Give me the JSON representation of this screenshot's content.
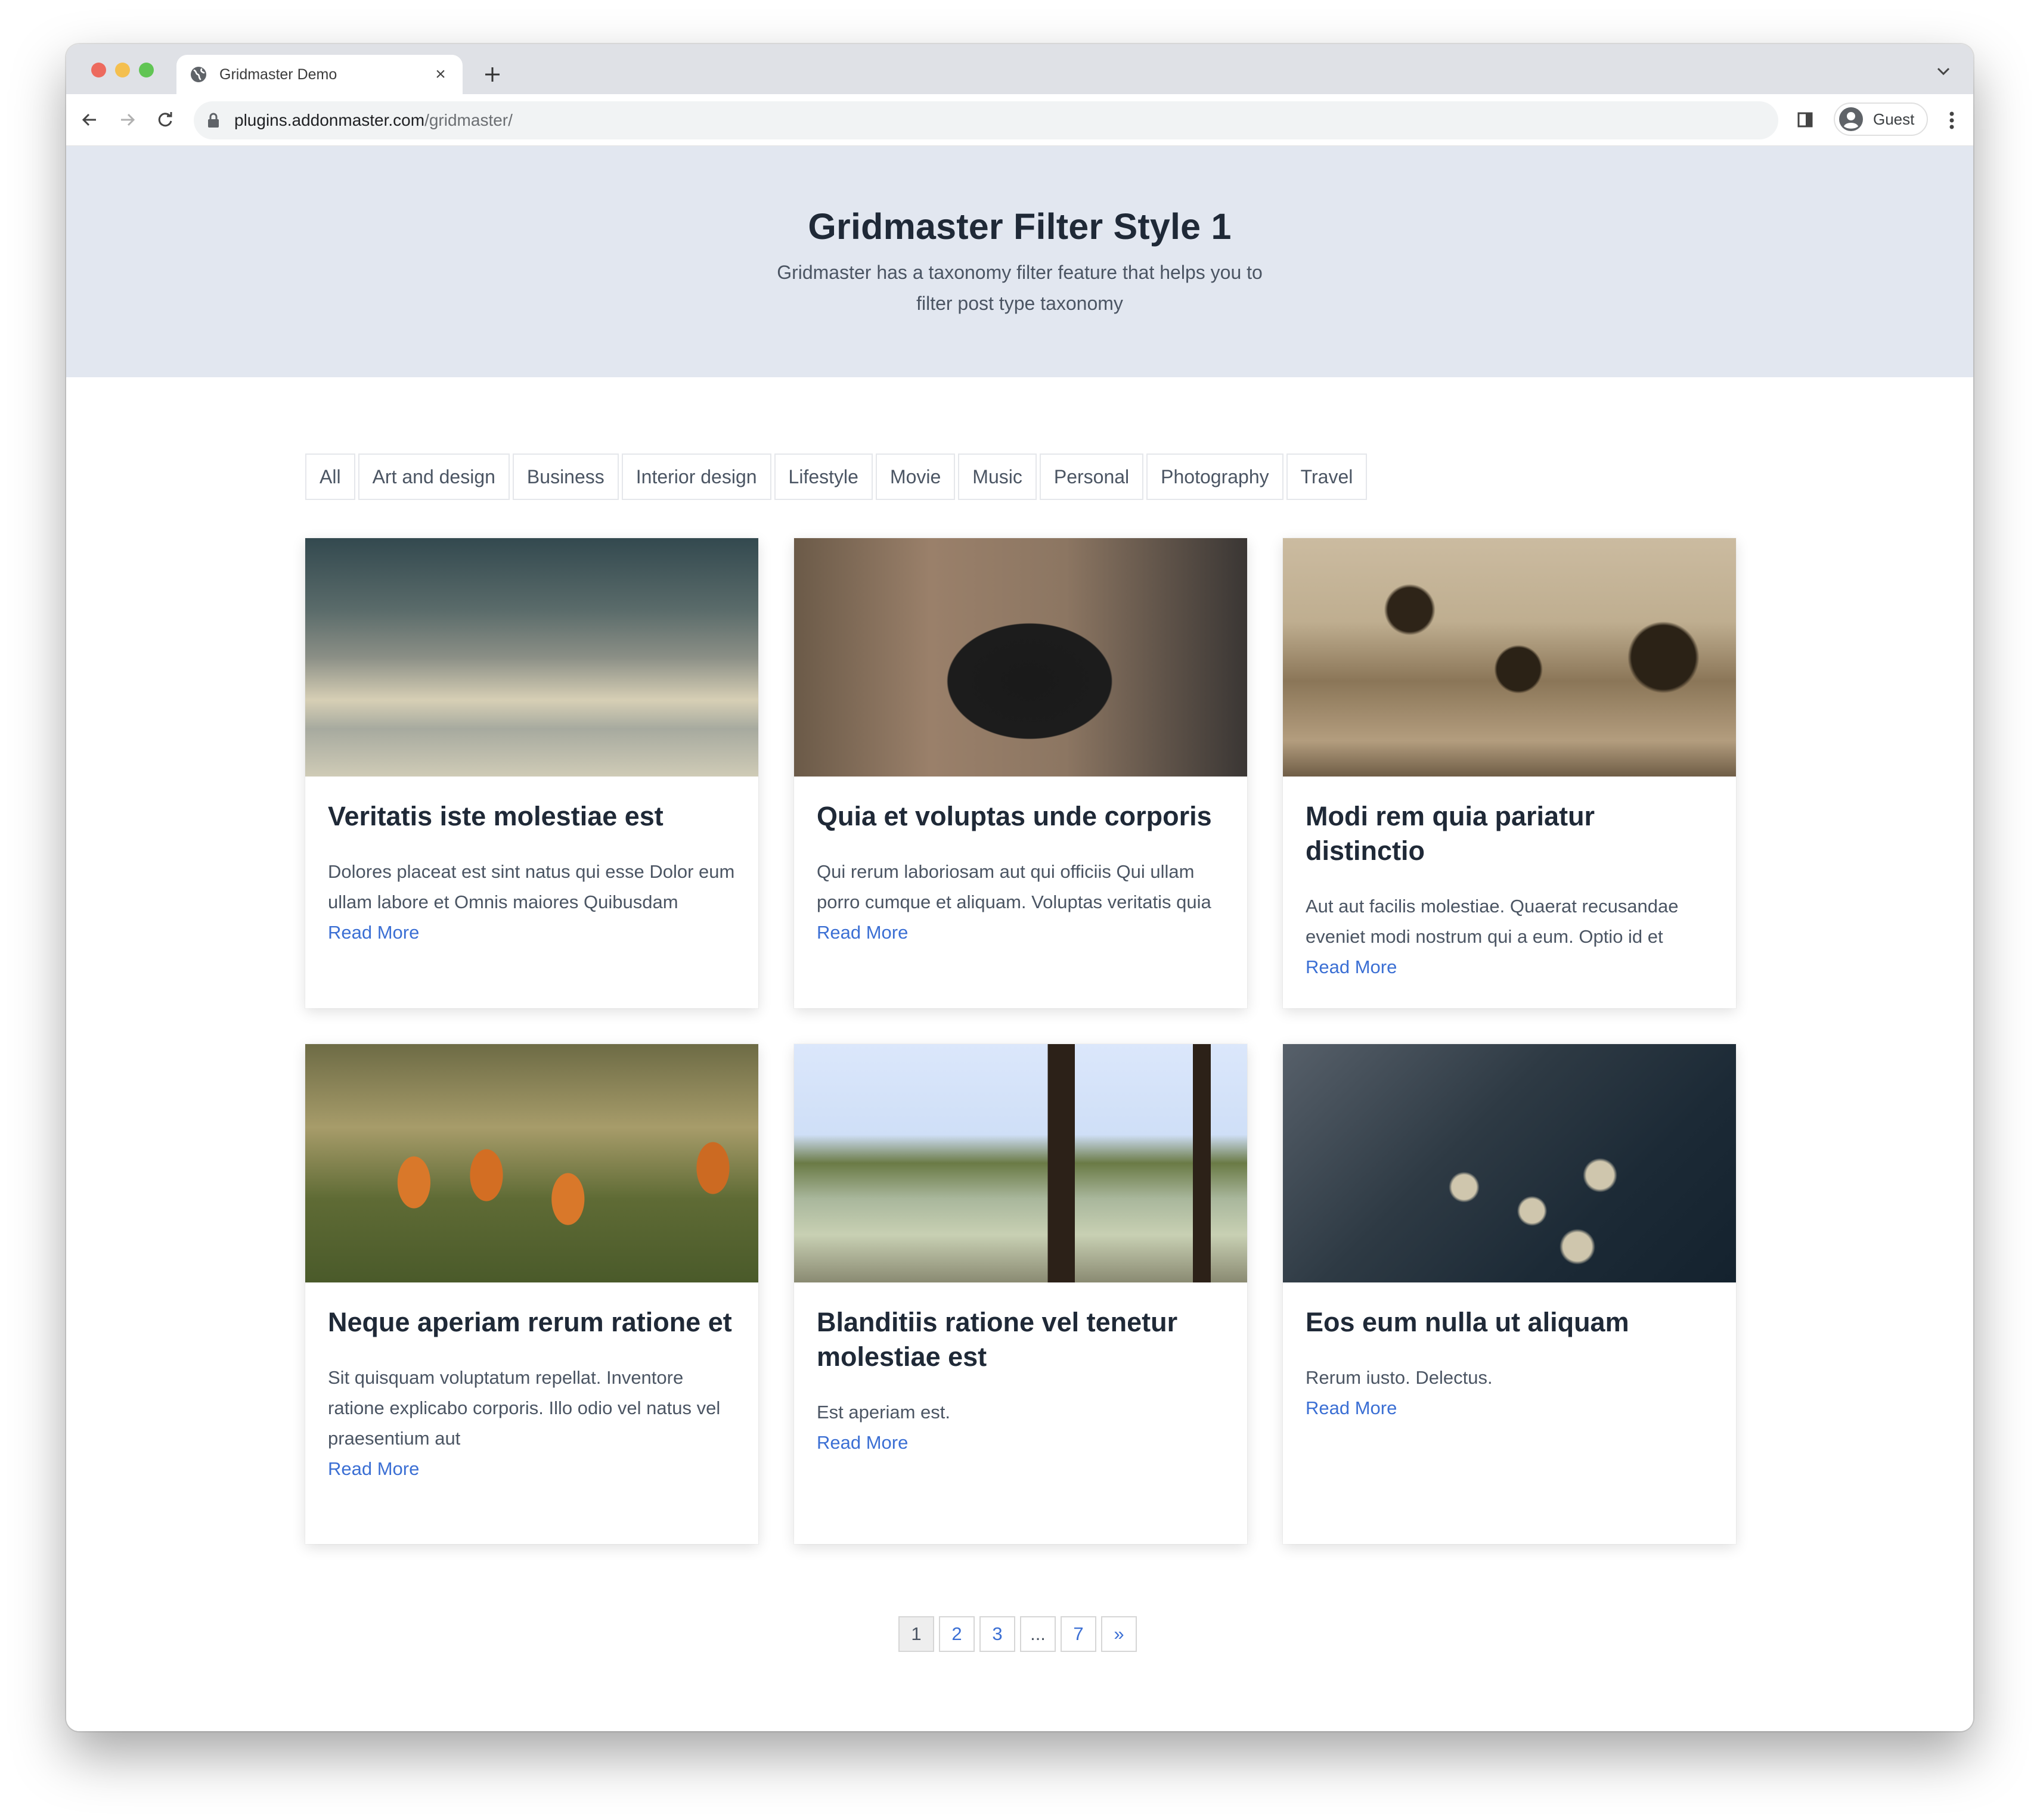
{
  "browser": {
    "tab_title": "Gridmaster Demo",
    "tab_favicon": "globe-icon",
    "url_host": "plugins.addonmaster.com",
    "url_path": "/gridmaster/",
    "profile_label": "Guest",
    "icons": {
      "back": "arrow-left-icon",
      "forward": "arrow-right-icon",
      "reload": "reload-icon",
      "lock": "lock-icon",
      "side_panel": "side-panel-icon",
      "menu": "kebab-menu-icon",
      "tab_search": "chevron-down-icon",
      "new_tab": "plus-icon",
      "close_tab": "close-icon"
    },
    "traffic_lights": {
      "close": "#ed6a5e",
      "minimize": "#f4bf4f",
      "zoom": "#61c554"
    }
  },
  "hero": {
    "title": "Gridmaster Filter Style 1",
    "subtitle": "Gridmaster has a taxonomy filter feature that helps you to filter post type taxonomy"
  },
  "filters": [
    "All",
    "Art and design",
    "Business",
    "Interior design",
    "Lifestyle",
    "Movie",
    "Music",
    "Personal",
    "Photography",
    "Travel"
  ],
  "posts": [
    {
      "title": "Veritatis iste molestiae est",
      "excerpt": "Dolores placeat est sint natus qui esse Dolor eum ullam labore et Omnis maiores Quibusdam",
      "link": "Read More",
      "image": "cloudy-sky"
    },
    {
      "title": "Quia et voluptas unde corporis",
      "excerpt": "Qui rerum laboriosam aut qui officiis Qui ullam porro cumque et aliquam. Voluptas veritatis quia",
      "link": "Read More",
      "image": "hand-holding-camera"
    },
    {
      "title": "Modi rem quia pariatur distinctio",
      "excerpt": "Aut aut facilis molestiae. Quaerat recusandae eveniet modi nostrum qui a eum. Optio id et",
      "link": "Read More",
      "image": "sepia-hills-with-trees"
    },
    {
      "title": "Neque aperiam rerum ratione et",
      "excerpt": "Sit quisquam voluptatum repellat. Inventore ratione explicabo corporis. Illo odio vel natus vel praesentium aut",
      "link": "Read More",
      "image": "orange-tulips-in-forest"
    },
    {
      "title": "Blanditiis ratione vel tenetur molestiae est",
      "excerpt": "Est aperiam est.",
      "link": "Read More",
      "image": "misty-lake-with-dock"
    },
    {
      "title": "Eos eum nulla ut aliquam",
      "excerpt": "Rerum iusto. Delectus.",
      "link": "Read More",
      "image": "vintage-typewriter"
    }
  ],
  "pagination": {
    "current": "1",
    "items": [
      "1",
      "2",
      "3",
      "...",
      "7",
      "»"
    ]
  },
  "colors": {
    "hero_bg": "#e2e7f0",
    "link": "#3b6fd4",
    "heading": "#1f2937",
    "body_text": "#4b5563"
  }
}
